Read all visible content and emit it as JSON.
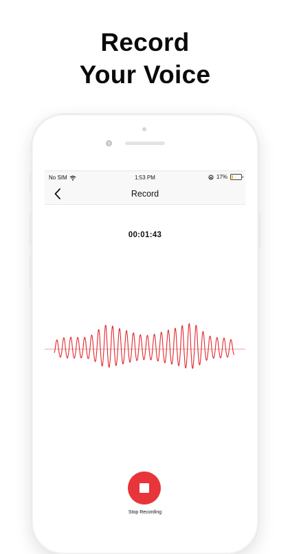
{
  "headline": {
    "line1": "Record",
    "line2": "Your Voice"
  },
  "status_bar": {
    "carrier": "No SIM",
    "time": "1:53 PM",
    "battery": "17%",
    "battery_level": 0.17,
    "icons": [
      "wifi-icon",
      "rotation-lock-icon",
      "battery-icon"
    ]
  },
  "nav": {
    "title": "Record",
    "back_icon": "chevron-left-icon"
  },
  "recorder": {
    "elapsed": "00:01:43",
    "stop_label": "Stop Recording",
    "stop_icon": "stop-icon"
  },
  "colors": {
    "accent": "#e8353a",
    "wave": "#e0262c",
    "battery_fill": "#f2c200"
  }
}
